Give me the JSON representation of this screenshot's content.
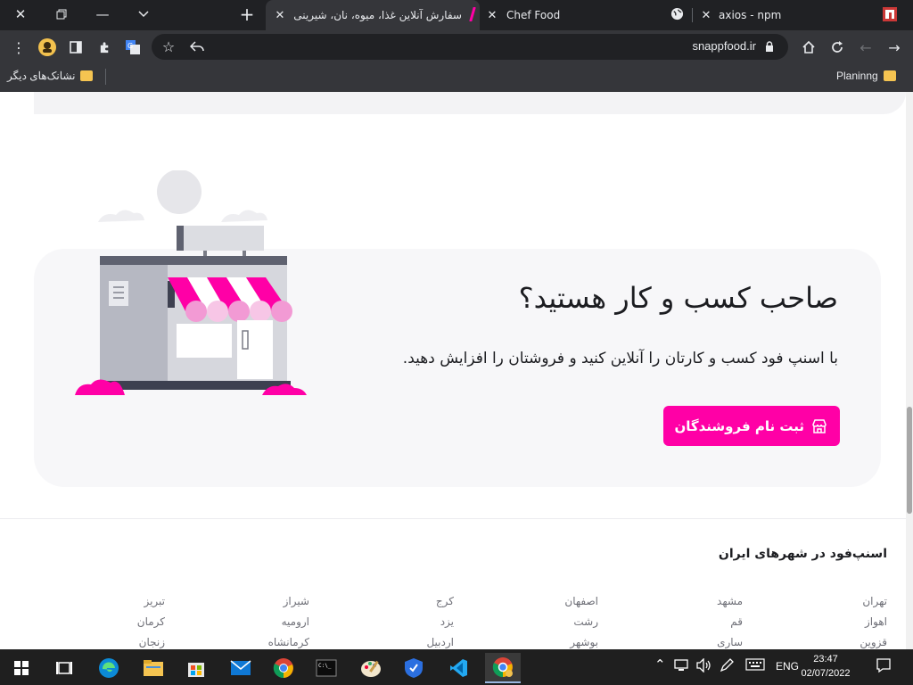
{
  "browser": {
    "tabs": [
      {
        "title": "axios - npm",
        "icon": "npm-icon"
      },
      {
        "title": "Chef Food",
        "icon": "globe-icon"
      },
      {
        "title": "سفارش آنلاین غذا، میوه، نان، شیرینی",
        "icon": "snappfood-icon"
      }
    ],
    "address": "snappfood.ir",
    "bookmarks": {
      "left_folder": "نشانک‌های دیگر",
      "right_folder": "Planinng"
    }
  },
  "page": {
    "vendor_section": {
      "title": "صاحب کسب و کار هستید؟",
      "subtitle": "با اسنپ فود کسب و کارتان را آنلاین کنید و فروشتان را افزایش دهید.",
      "button_label": "ثبت نام فروشندگان"
    },
    "cities": {
      "title": "اسنپ‌فود در شهرهای ایران",
      "columns": [
        [
          "تهران",
          "اهواز",
          "قزوین"
        ],
        [
          "مشهد",
          "قم",
          "ساری"
        ],
        [
          "اصفهان",
          "رشت",
          "بوشهر"
        ],
        [
          "کرج",
          "یزد",
          "اردبیل"
        ],
        [
          "شیراز",
          "ارومیه",
          "کرمانشاه"
        ],
        [
          "تبریز",
          "کرمان",
          "زنجان"
        ]
      ]
    }
  },
  "taskbar": {
    "language": "ENG",
    "time": "23:47",
    "date": "02/07/2022"
  },
  "colors": {
    "brand_pink": "#ff00a6",
    "chrome_dark": "#202124",
    "chrome_toolbar": "#35363a"
  }
}
